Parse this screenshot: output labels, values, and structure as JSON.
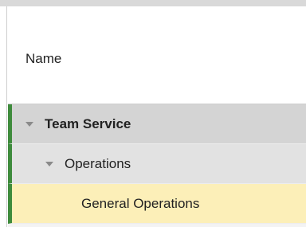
{
  "grid": {
    "column_header": "Name"
  },
  "tree": {
    "rows": [
      {
        "label": "Team Service",
        "expanded": true,
        "icon": "caret-down-icon"
      },
      {
        "label": "Operations",
        "expanded": true,
        "icon": "caret-down-icon"
      },
      {
        "label": "General Operations",
        "selected": true
      }
    ]
  },
  "colors": {
    "accent_bar": "#3e8b3c",
    "selected_row": "#fcefb8",
    "group_row": "#d4d4d4",
    "subgroup_row": "#e2e2e2"
  }
}
